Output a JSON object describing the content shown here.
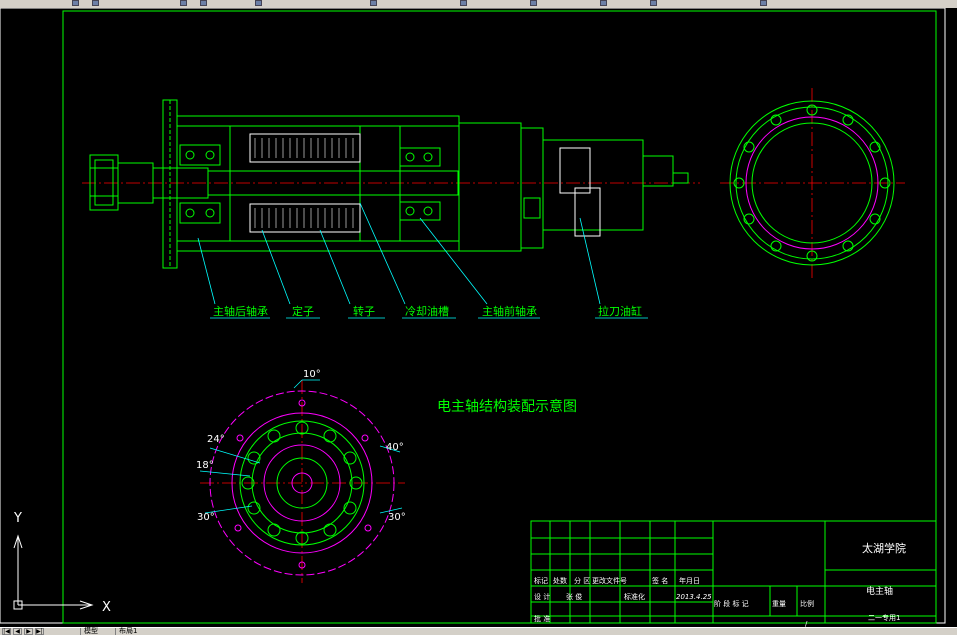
{
  "drawing": {
    "title": "电主轴结构装配示意图",
    "callouts": [
      "主轴后轴承",
      "定子",
      "转子",
      "冷却油槽",
      "主轴前轴承",
      "拉刀油缸"
    ],
    "angles": {
      "top": "10°",
      "upper_left": "24°",
      "left": "18°",
      "lower_left": "30°",
      "upper_right": "40°",
      "lower_right": "30°"
    }
  },
  "title_block": {
    "school": "太湖学院",
    "part_name": "电主轴",
    "date": "2013.4.25",
    "row_labels": [
      "标记",
      "处数",
      "分 区",
      "更改文件号",
      "签 名",
      "年月日"
    ],
    "row2": [
      "设 计",
      "张 俊",
      "标准化"
    ],
    "stage_labels": [
      "阶 段 标 记",
      "重量",
      "比例"
    ],
    "scale": "/",
    "approve": "批 准",
    "partial": "二一专用1"
  },
  "ucs": {
    "y_label": "Y",
    "x_label": "X"
  },
  "status_bar": {
    "nav_buttons": [
      "|◀",
      "◀",
      "▶",
      "▶|"
    ],
    "tabs": [
      "模型",
      "布局1"
    ]
  },
  "colors": {
    "background": "#000000",
    "line": "#00ff00",
    "center": "#ff0000",
    "dim": "#00ffff",
    "magenta": "#ff00ff",
    "white": "#ffffff"
  }
}
